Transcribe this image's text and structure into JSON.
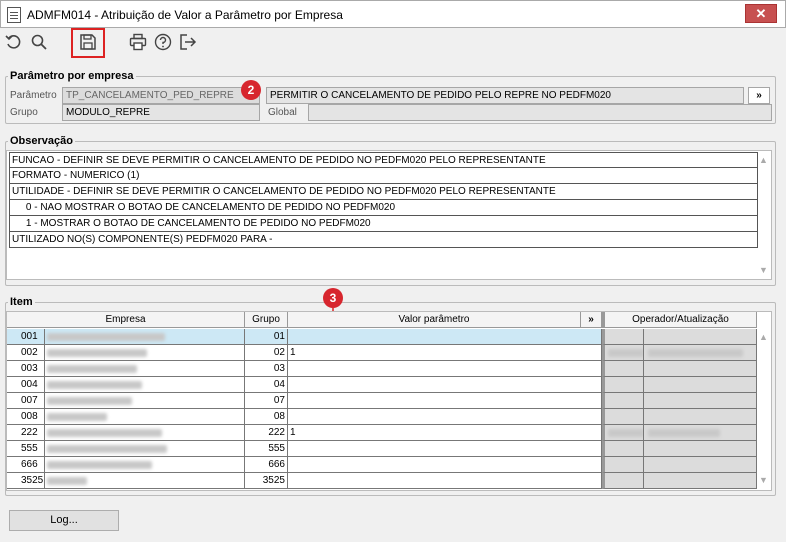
{
  "window": {
    "title": "ADMFM014 - Atribuição de Valor a Parâmetro por Empresa",
    "close": "✕"
  },
  "toolbar": [
    "undo-icon",
    "search-icon",
    "save-icon",
    "print-icon",
    "help-icon",
    "exit-icon"
  ],
  "parametro_section": {
    "legend": "Parâmetro por empresa",
    "parametro_label": "Parâmetro",
    "parametro_value": "TP_CANCELAMENTO_PED_REPRE",
    "descricao_value": "PERMITIR O CANCELAMENTO DE PEDIDO PELO REPRE  NO PEDFM020",
    "more_button": "»",
    "grupo_label": "Grupo",
    "grupo_value": "MODULO_REPRE",
    "global_label": "Global",
    "global_value": ""
  },
  "badges": {
    "b2": "2",
    "b3": "3"
  },
  "observacao": {
    "legend": "Observação",
    "lines": [
      "FUNCAO - DEFINIR SE DEVE PERMITIR O CANCELAMENTO DE PEDIDO NO PEDFM020 PELO REPRESENTANTE",
      "FORMATO - NUMERICO (1)",
      "UTILIDADE - DEFINIR SE DEVE PERMITIR O CANCELAMENTO DE PEDIDO NO PEDFM020 PELO REPRESENTANTE",
      "     0 - NAO MOSTRAR O BOTAO DE CANCELAMENTO DE PEDIDO NO PEDFM020",
      "     1 - MOSTRAR O BOTAO DE CANCELAMENTO DE PEDIDO NO PEDFM020",
      "UTILIZADO NO(S) COMPONENTE(S) PEDFM020  PARA  -"
    ]
  },
  "item": {
    "legend": "Item",
    "headers": {
      "empresa": "Empresa",
      "grupo": "Grupo",
      "valor": "Valor parâmetro",
      "more": "»",
      "operador": "Operador/Atualização"
    },
    "rows": [
      {
        "code": "001",
        "grupo": "01",
        "valor": "",
        "op": false
      },
      {
        "code": "002",
        "grupo": "02",
        "valor": "1",
        "op": true
      },
      {
        "code": "003",
        "grupo": "03",
        "valor": "",
        "op": false
      },
      {
        "code": "004",
        "grupo": "04",
        "valor": "",
        "op": false
      },
      {
        "code": "007",
        "grupo": "07",
        "valor": "",
        "op": false
      },
      {
        "code": "008",
        "grupo": "08",
        "valor": "",
        "op": false
      },
      {
        "code": "222",
        "grupo": "222",
        "valor": "1",
        "op": true
      },
      {
        "code": "555",
        "grupo": "555",
        "valor": "",
        "op": false
      },
      {
        "code": "666",
        "grupo": "666",
        "valor": "",
        "op": false
      },
      {
        "code": "3525",
        "grupo": "3525",
        "valor": "",
        "op": false
      }
    ]
  },
  "log_button": "Log..."
}
